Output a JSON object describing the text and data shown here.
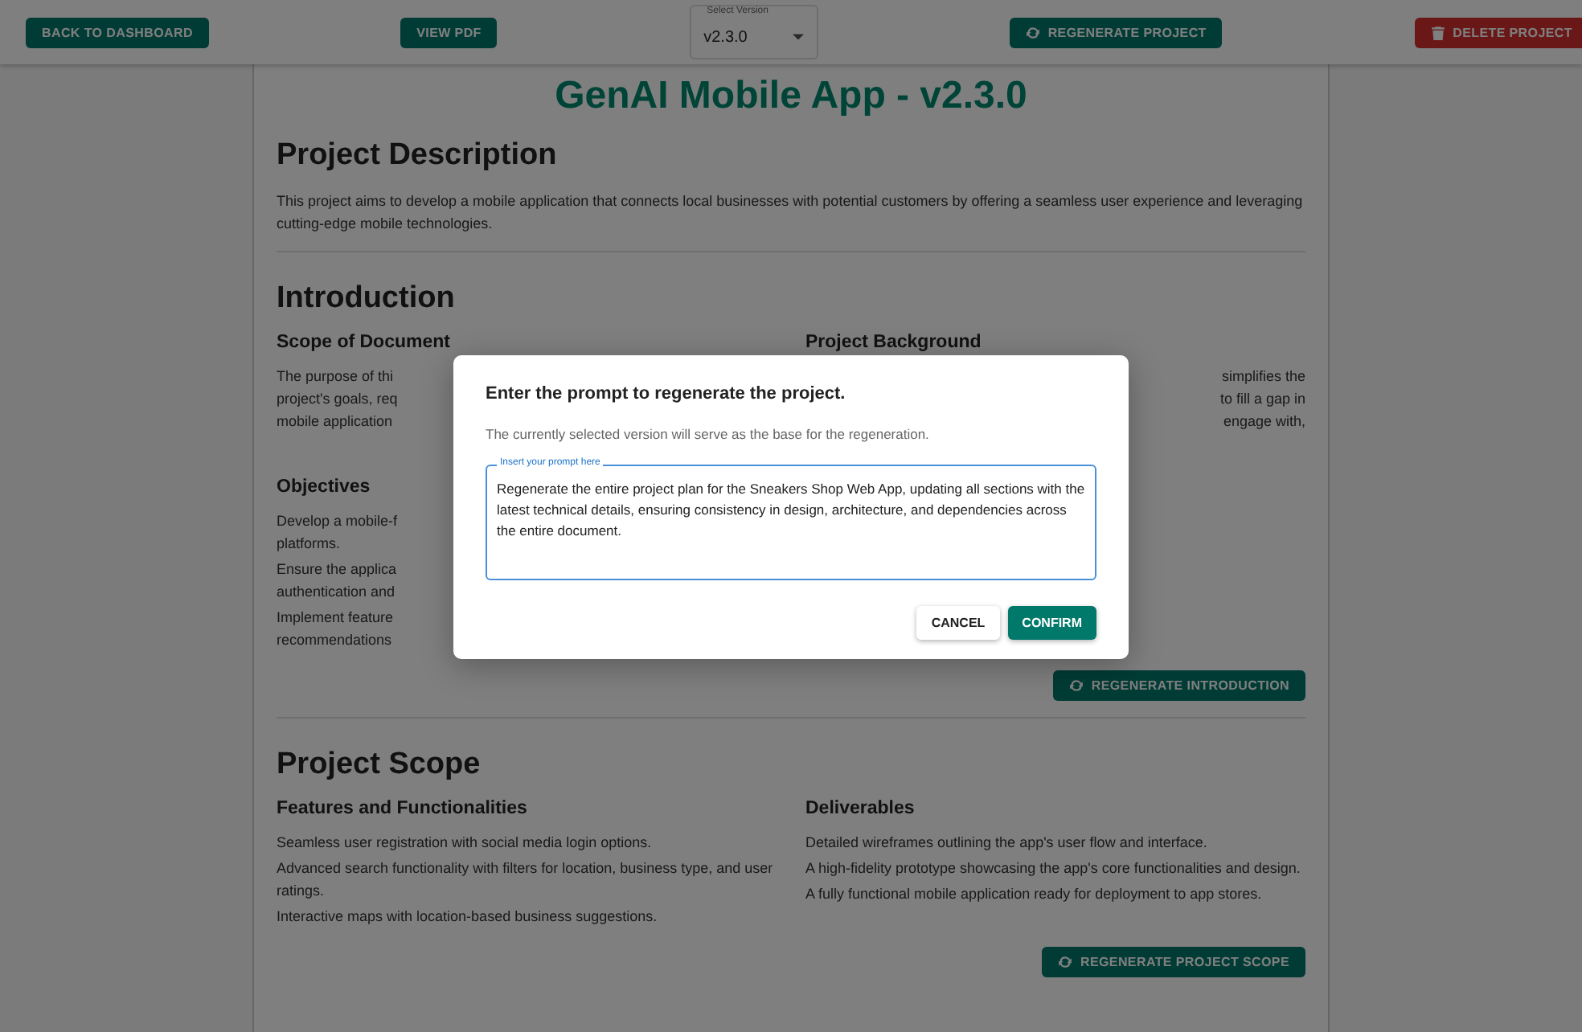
{
  "header": {
    "back_button": "BACK TO DASHBOARD",
    "pdf_button": "VIEW PDF",
    "version_select": {
      "label": "Select Version",
      "value": "v2.3.0"
    },
    "regenerate_button": "REGENERATE PROJECT",
    "delete_button": "DELETE PROJECT"
  },
  "title": "GenAI Mobile App - v2.3.0",
  "description": {
    "heading": "Project Description",
    "text": "This project aims to develop a mobile application that connects local businesses with potential customers by offering a seamless user experience and leveraging cutting-edge mobile technologies."
  },
  "introduction": {
    "heading": "Introduction",
    "left_heading": "Scope of Document",
    "left_lines": [
      "The purpose of thi",
      "project's goals, req",
      "mobile application"
    ],
    "right_heading": "Project Background",
    "right_lines": [
      "simplifies the",
      "to fill a gap in",
      "engage with,"
    ],
    "objectives_heading": "Objectives",
    "objectives": [
      [
        "Develop a mobile-f",
        "platforms."
      ],
      [
        "Ensure the applica",
        "authentication and"
      ],
      [
        "Implement feature",
        "recommendations"
      ]
    ],
    "button": "REGENERATE INTRODUCTION"
  },
  "scope": {
    "heading": "Project Scope",
    "columns": [
      {
        "heading": "Features and Functionalities",
        "items": [
          "Seamless user registration with social media login options.",
          "Advanced search functionality with filters for location, business type, and user ratings.",
          "Interactive maps with location-based business suggestions."
        ]
      },
      {
        "heading": "Deliverables",
        "items": [
          "Detailed wireframes outlining the app's user flow and interface.",
          "A high-fidelity prototype showcasing the app's core functionalities and design.",
          "A fully functional mobile application ready for deployment to app stores."
        ]
      }
    ],
    "button": "REGENERATE PROJECT SCOPE"
  },
  "dialog": {
    "title": "Enter the prompt to regenerate the project.",
    "subtitle": "The currently selected version will serve as the base for the regeneration.",
    "field": {
      "label": "Insert your prompt here",
      "value": "Regenerate the entire project plan for the Sneakers Shop Web App, updating all sections with the latest technical details, ensuring consistency in design, architecture, and dependencies across the entire document."
    },
    "buttons": [
      {
        "label": "CANCEL",
        "kind": "text"
      },
      {
        "label": "CONFIRM",
        "kind": "primary"
      }
    ]
  }
}
